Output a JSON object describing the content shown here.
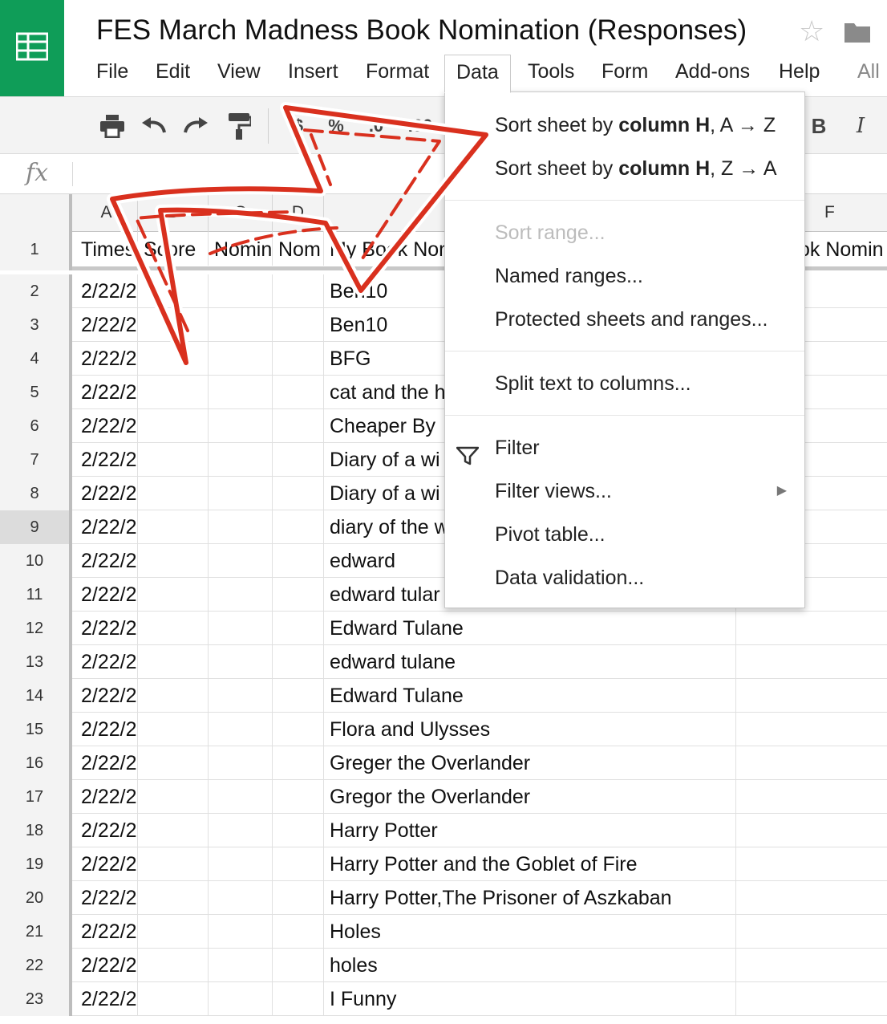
{
  "header": {
    "title": "FES March Madness Book Nomination (Responses)",
    "menu": [
      "File",
      "Edit",
      "View",
      "Insert",
      "Format",
      "Data",
      "Tools",
      "Form",
      "Add-ons",
      "Help",
      "All"
    ]
  },
  "toolbar": {
    "percent_label": "%",
    "decimal_decrease_label": ".0",
    "decimal_increase_label": ".00",
    "bold_label": "B",
    "italic_label": "I"
  },
  "formula_bar": {
    "fx_label": "fx",
    "value": ""
  },
  "columns": [
    "A",
    "B",
    "C",
    "D",
    "F"
  ],
  "header_row": {
    "number": "1",
    "cells": [
      "Times",
      "Score",
      "Nomin",
      "Nom",
      "My Book Nom",
      "ok Nomin"
    ]
  },
  "rows": [
    {
      "n": "2",
      "a": "2/22/2",
      "e": "Ben10"
    },
    {
      "n": "3",
      "a": "2/22/2",
      "e": "Ben10"
    },
    {
      "n": "4",
      "a": "2/22/2",
      "e": "BFG"
    },
    {
      "n": "5",
      "a": "2/22/2",
      "e": "cat and the h"
    },
    {
      "n": "6",
      "a": "2/22/2",
      "e": "Cheaper By"
    },
    {
      "n": "7",
      "a": "2/22/2",
      "e": "Diary of a wi"
    },
    {
      "n": "8",
      "a": "2/22/2",
      "e": "Diary of a wi"
    },
    {
      "n": "9",
      "a": "2/22/2",
      "e": "diary of the w"
    },
    {
      "n": "10",
      "a": "2/22/2",
      "e": "edward"
    },
    {
      "n": "11",
      "a": "2/22/2",
      "e": "edward tular"
    },
    {
      "n": "12",
      "a": "2/22/2",
      "e": "Edward Tulane"
    },
    {
      "n": "13",
      "a": "2/22/2",
      "e": "edward tulane"
    },
    {
      "n": "14",
      "a": "2/22/2",
      "e": "Edward Tulane"
    },
    {
      "n": "15",
      "a": "2/22/2",
      "e": "Flora and Ulysses"
    },
    {
      "n": "16",
      "a": "2/22/2",
      "e": "Greger the Overlander"
    },
    {
      "n": "17",
      "a": "2/22/2",
      "e": "Gregor the Overlander"
    },
    {
      "n": "18",
      "a": "2/22/2",
      "e": "Harry Potter"
    },
    {
      "n": "19",
      "a": "2/22/2",
      "e": "Harry Potter and the Goblet of Fire"
    },
    {
      "n": "20",
      "a": "2/22/2",
      "e": "Harry Potter,The Prisoner of Aszkaban"
    },
    {
      "n": "21",
      "a": "2/22/2",
      "e": "Holes"
    },
    {
      "n": "22",
      "a": "2/22/2",
      "e": "holes"
    },
    {
      "n": "23",
      "a": "2/22/2",
      "e": "I Funny"
    }
  ],
  "data_menu": {
    "sort_az_prefix": "Sort sheet by ",
    "sort_az_bold": "column H",
    "sort_az_suffix": ", A → Z",
    "sort_za_prefix": "Sort sheet by ",
    "sort_za_bold": "column H",
    "sort_za_suffix": ", Z → A",
    "sort_range": "Sort range...",
    "named_ranges": "Named ranges...",
    "protected": "Protected sheets and ranges...",
    "split_text": "Split text to columns...",
    "filter": "Filter",
    "filter_views": "Filter views...",
    "pivot_table": "Pivot table...",
    "data_validation": "Data validation..."
  },
  "colors": {
    "brand_green": "#0f9d58",
    "annotation_red": "#d9301e"
  }
}
